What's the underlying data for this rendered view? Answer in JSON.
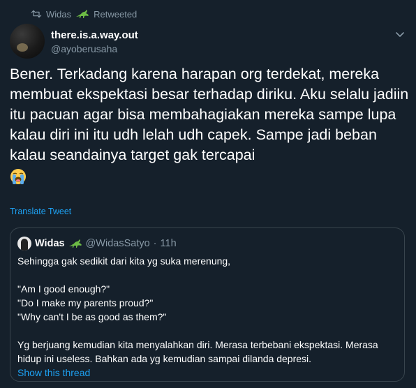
{
  "retweet": {
    "user": "Widas",
    "label": "Retweeted"
  },
  "author": {
    "display_name": "there.is.a.way.out",
    "handle": "@ayoberusaha"
  },
  "tweet": {
    "text": "Bener. Terkadang karena harapan org terdekat, mereka membuat ekspektasi besar terhadap diriku. Aku selalu jadiin itu pacuan agar bisa membahagiakan mereka sampe lupa kalau diri ini itu udh lelah udh capek. Sampe jadi beban kalau seandainya target gak tercapai",
    "emoji": "loudly-crying-face",
    "translate_label": "Translate Tweet"
  },
  "quote": {
    "name": "Widas",
    "handle": "@WidasSatyo",
    "separator": "·",
    "time": "11h",
    "lines": {
      "p1": "Sehingga gak sedikit dari kita yg suka merenung,",
      "q1": "\"Am I good enough?\"",
      "q2": "\"Do I make my parents proud?\"",
      "q3": "\"Why can't I be as good as them?\"",
      "p2": "Yg berjuang kemudian kita menyalahkan diri. Merasa terbebani ekspektasi. Merasa hidup ini useless. Bahkan ada yg kemudian sampai dilanda depresi."
    },
    "show_thread": "Show this thread"
  },
  "colors": {
    "background": "#15202b",
    "secondary": "#8899a6",
    "accent": "#1da1f2",
    "border": "#38444d"
  }
}
